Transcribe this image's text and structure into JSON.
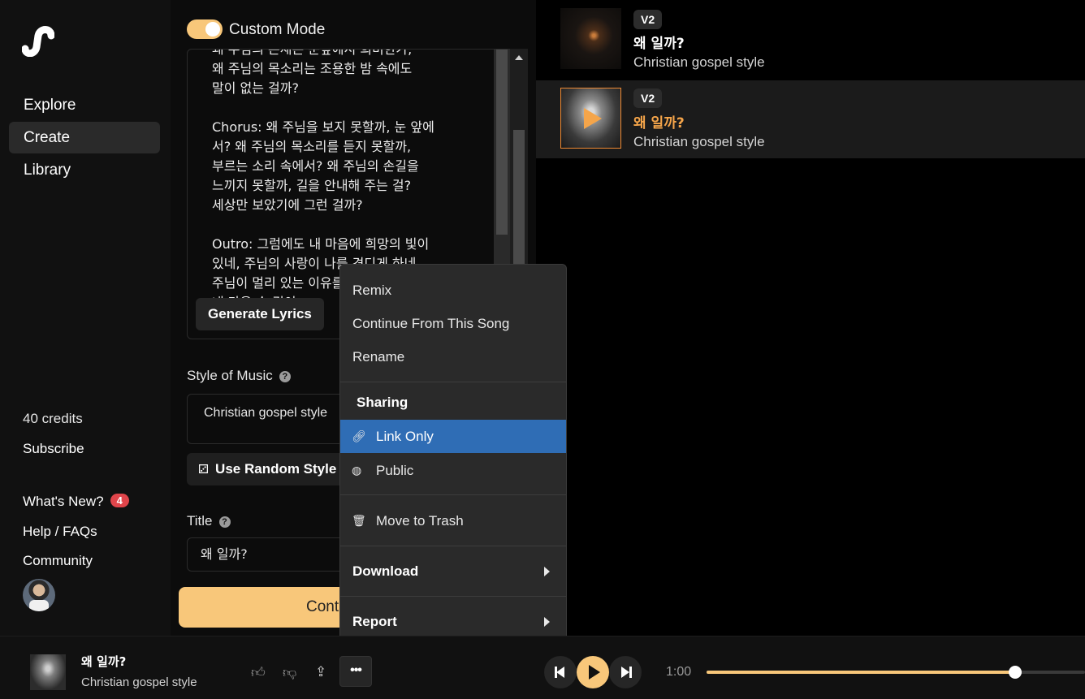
{
  "sidebar": {
    "nav": [
      {
        "label": "Explore",
        "active": false
      },
      {
        "label": "Create",
        "active": true
      },
      {
        "label": "Library",
        "active": false
      }
    ],
    "credits": "40 credits",
    "subscribe": "Subscribe",
    "whats_new": "What's New?",
    "whats_new_badge": "4",
    "help": "Help / FAQs",
    "community": "Community"
  },
  "create": {
    "mode_label": "Custom Mode",
    "lyrics": "왜 주님의 존재는 눈앞에서 희미한가,\n왜 주님의 목소리는 조용한 밤 속에도\n말이 없는 걸까?\n\nChorus: 왜 주님을 보지 못할까, 눈 앞에\n서? 왜 주님의 목소리를 듣지 못할까,\n부르는 소리 속에서? 왜 주님의 손길을\n느끼지 못할까, 길을 안내해 주는 걸?\n세상만 보았기에 그런 걸까?\n\nOutro: 그럼에도 내 마음에 희망의 빛이\n있네, 주님의 사랑이 나를 견디게 하네\n주님이 멀리 있는 이유를 알게 될 때,\n내 마음 속 깊이",
    "generate_lyrics": "Generate Lyrics",
    "style_label": "Style of Music",
    "style_value": "Christian gospel style",
    "random_style": "Use Random Style",
    "title_label": "Title",
    "title_value": "왜 일까?",
    "create_button": "Cont"
  },
  "songs": [
    {
      "version": "V2",
      "title": "왜 일까?",
      "style": "Christian gospel style",
      "selected": false
    },
    {
      "version": "V2",
      "title": "왜 일까?",
      "style": "Christian gospel style",
      "selected": true
    }
  ],
  "menu": {
    "remix": "Remix",
    "continue": "Continue From This Song",
    "rename": "Rename",
    "sharing_heading": "Sharing",
    "link_only": "Link Only",
    "public": "Public",
    "trash": "Move to Trash",
    "download": "Download",
    "report": "Report"
  },
  "player": {
    "title": "왜 일까?",
    "style": "Christian gospel style",
    "time": "1:00",
    "progress": 0.815
  },
  "colors": {
    "accent": "#f8c77a",
    "playing": "#f5a54a",
    "selected_menu": "#2f6db5",
    "badge": "#e0454b"
  }
}
